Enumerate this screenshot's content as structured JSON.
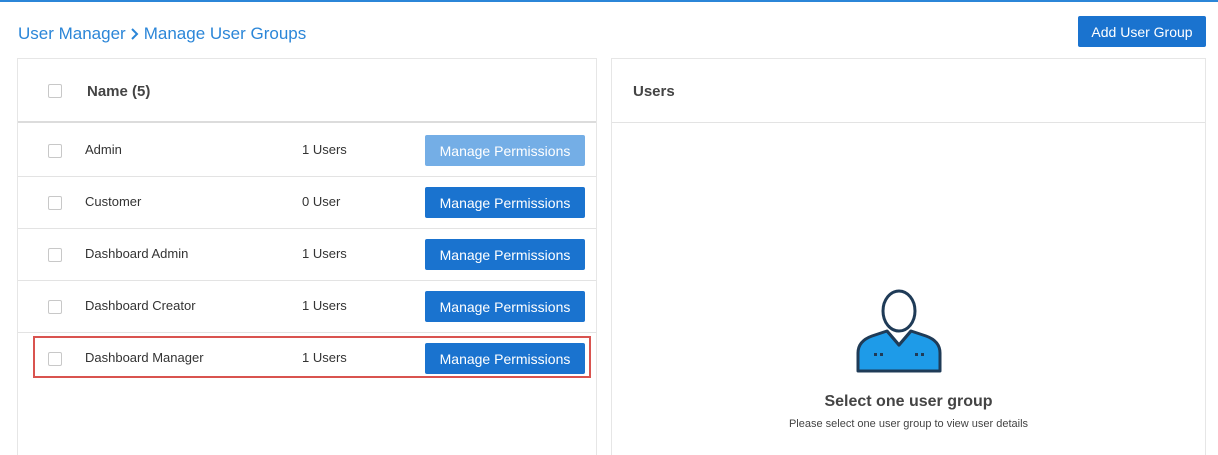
{
  "breadcrumb": {
    "root": "User Manager",
    "current": "Manage User Groups"
  },
  "header": {
    "add_button_label": "Add User Group"
  },
  "groups_panel": {
    "header_title": "Name (5)",
    "rows": [
      {
        "name": "Admin",
        "count": "1 Users",
        "button_label": "Manage Permissions",
        "button_state": "disabled"
      },
      {
        "name": "Customer",
        "count": "0 User",
        "button_label": "Manage Permissions",
        "button_state": "enabled"
      },
      {
        "name": "Dashboard Admin",
        "count": "1 Users",
        "button_label": "Manage Permissions",
        "button_state": "enabled"
      },
      {
        "name": "Dashboard Creator",
        "count": "1 Users",
        "button_label": "Manage Permissions",
        "button_state": "enabled"
      },
      {
        "name": "Dashboard Manager",
        "count": "1 Users",
        "button_label": "Manage Permissions",
        "button_state": "enabled",
        "highlighted": true
      }
    ]
  },
  "users_panel": {
    "header_title": "Users",
    "empty_icon": "user-avatar-icon",
    "empty_title": "Select one user group",
    "empty_subtitle": "Please select one user group to view user details"
  },
  "colors": {
    "accent": "#1a73cf",
    "link": "#2b86d8",
    "disabled_button": "#74aee6",
    "highlight_border": "#d9534f",
    "avatar_fill": "#1e9be8",
    "avatar_outline": "#1f3b57"
  }
}
